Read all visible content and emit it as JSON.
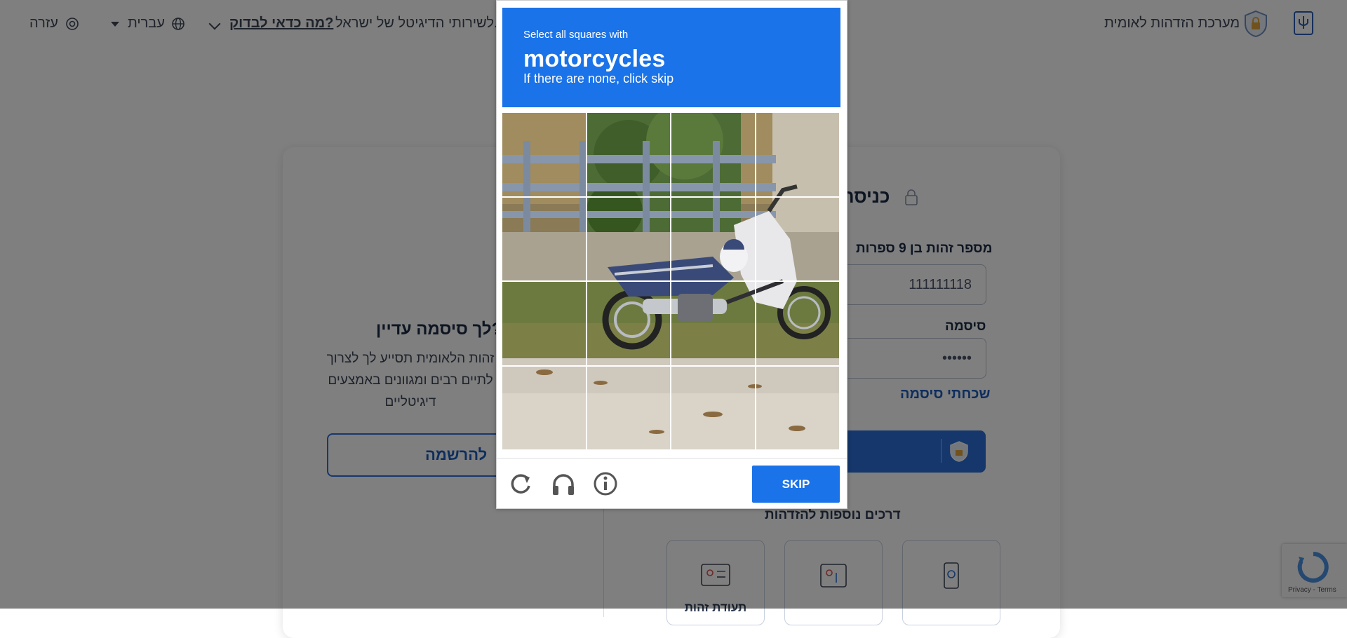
{
  "topbar": {
    "brand": "מערכת הזדהות לאומית",
    "help": "עזרה",
    "language": "עברית",
    "check_link": "מה כדאי לבדוק?",
    "tagline": "לשירותי הדיגיטל של ישראל."
  },
  "page": {
    "title": "ה"
  },
  "login": {
    "title": "כניסה",
    "id_label": "מספר זהות בן 9 ספרות",
    "id_value": "111111118",
    "password_label": "סיסמה",
    "password_value": "••••••",
    "forgot": "שכחתי סיסמה",
    "more_ways": "דרכים נוספות להזדהות",
    "ways": [
      {
        "label": "",
        "icon": "phone-link-icon"
      },
      {
        "label": "",
        "icon": "person-card-icon"
      },
      {
        "label": "תעודת זהות",
        "icon": "id-card-icon"
      }
    ]
  },
  "register": {
    "title": "לך סיסמה עדיין?",
    "text": "זהות הלאומית תסייע לך לצרוך לתיים רבים ומגוונים באמצעים דיגיטליים",
    "button": "להרשמה"
  },
  "captcha": {
    "instruction_small": "Select all squares with",
    "target": "motorcycles",
    "instruction_sub": "If there are none, click skip",
    "skip": "SKIP",
    "grid": {
      "rows": 4,
      "cols": 4
    },
    "icons": [
      "refresh-icon",
      "headphones-icon",
      "info-icon"
    ]
  },
  "recaptcha_badge": {
    "terms": "Privacy - Terms"
  },
  "colors": {
    "captcha_blue": "#1a73e8",
    "brand_blue": "#2b6ed8",
    "overlay": "rgba(0,0,0,0.5)"
  }
}
